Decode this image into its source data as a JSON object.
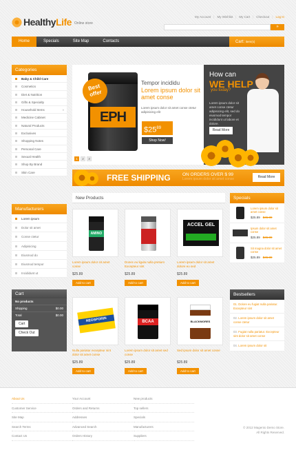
{
  "header": {
    "logo_part1": "Healthy",
    "logo_part2": "Life",
    "logo_sub": "Online store",
    "links": [
      "My Account",
      "My Wishlist",
      "My Cart",
      "Checkout"
    ],
    "login": "Log In"
  },
  "nav": {
    "items": [
      "Home",
      "Specials",
      "Site Map",
      "Contacts"
    ],
    "cart_label": "Cart:",
    "cart_items": "item(s)"
  },
  "categories": {
    "title": "Categories",
    "items": [
      "Baby & Child Care",
      "Cosmetics",
      "Diet & Nutrition",
      "Gifts & Specialty",
      "Household Items",
      "Medicine Cabinet",
      "Natural Products",
      "Exclusives",
      "Shopping Notes",
      "Personal Care",
      "Sexual Health",
      "Shop By Brand",
      "Skin Care"
    ]
  },
  "manufacturers": {
    "title": "Manufacturers",
    "items": [
      "Lorem ipsum",
      "Dolor sit amet",
      "Conse ctetur",
      "Adipisicing",
      "Eiusmod do",
      "Eiusmod tempor",
      "Incididunt ut"
    ]
  },
  "cart": {
    "title": "Cart",
    "empty": "No products",
    "shipping_label": "Shipping",
    "shipping_value": "$0.00",
    "total_label": "Total",
    "total_value": "$0.00",
    "cart_btn": "Cart",
    "checkout_btn": "Check Out"
  },
  "slider": {
    "badge": "Best offer",
    "product_label": "EPH",
    "line1": "Tempor incididu",
    "line2": "Lorem ipsum dolor sit amet conse",
    "desc": "Lorem ipsum dolor sit amet conse ctetur adipisicing elit",
    "price_main": "$25",
    "price_cents": "89",
    "shop_now": "Shop Now!",
    "pages": [
      "1",
      "2",
      "3"
    ]
  },
  "promo": {
    "line1": "How can",
    "line2": "WE HELP",
    "line3": "you today?",
    "desc": "Lorem ipsum dolor sit amet conse ctetur adipisicing elit, sed do eiusmod tempor incididunt ut labore et dolore.",
    "more": "Read More"
  },
  "shipping": {
    "title": "FREE SHIPPING",
    "sub1": "ON ORDERS OVER $ 99",
    "sub2": "Lorem ipsum dolor sit amet conse",
    "btn": "Read More"
  },
  "new_products": {
    "title": "New Products",
    "items": [
      {
        "name": "Lorem ipsum dolor sit amet conse",
        "price": "$25.89",
        "add": "Add to cart",
        "label": "AMINO"
      },
      {
        "name": "Donec eu ligula nulla pretium Excepteur sint",
        "price": "$25.89",
        "add": "Add to cart",
        "label": ""
      },
      {
        "name": "Lorem ipsum dolor sit amet dolore eu sed",
        "price": "$25.89",
        "add": "Add to cart",
        "label": "ACCEL GEL"
      },
      {
        "name": "Nulla pariatur excepteur sint dolor sit amet conse",
        "price": "$25.89",
        "add": "Add to cart",
        "label": "NEOSPORIN"
      },
      {
        "name": "Lorem ipsum dolor sit amet sed conse",
        "price": "$25.89",
        "add": "Add to cart",
        "label": "BCAA"
      },
      {
        "name": "Sed ipsum dolor sit amet conse",
        "price": "$25.89",
        "add": "Add to cart",
        "label": "BLACKMORES"
      }
    ]
  },
  "specials": {
    "title": "Specials",
    "items": [
      {
        "name": "Lorem ipsum dolor sit amet conse",
        "price": "$25.89",
        "old": "$45.89"
      },
      {
        "name": "Ipsum dolor sit amet conse",
        "price": "$25.89",
        "old": "$45.89"
      },
      {
        "name": "Sit magna dolor sit amet conse",
        "price": "$25.89",
        "old": "$45.89"
      }
    ]
  },
  "bestsellers": {
    "title": "Bestsellers",
    "items": [
      {
        "num": "01.",
        "text": "Dolore eu fugiat nulla pariatur. Excepteur sint"
      },
      {
        "num": "02.",
        "text": "Lorem ipsum dolor sit amet conse ctetur"
      },
      {
        "num": "03.",
        "text": "Fugiat nulla pariatur. Excepteur sint dolor sit amet conse"
      },
      {
        "num": "04.",
        "text": "Lorem ipsum dolor sit"
      }
    ]
  },
  "footer": {
    "col1": [
      "About Us",
      "Customer Service",
      "Site Map",
      "Search Terms",
      "Contact Us"
    ],
    "col2": [
      "Your Account",
      "Orders and Returns",
      "Addresses",
      "Advanced Search",
      "Orders History"
    ],
    "col3": [
      "New products",
      "Top sellers",
      "Specials",
      "Manufacturers",
      "Suppliers"
    ],
    "copy1": "© 2012 Magento Demo Store.",
    "copy2": "All Rights Reserved."
  }
}
